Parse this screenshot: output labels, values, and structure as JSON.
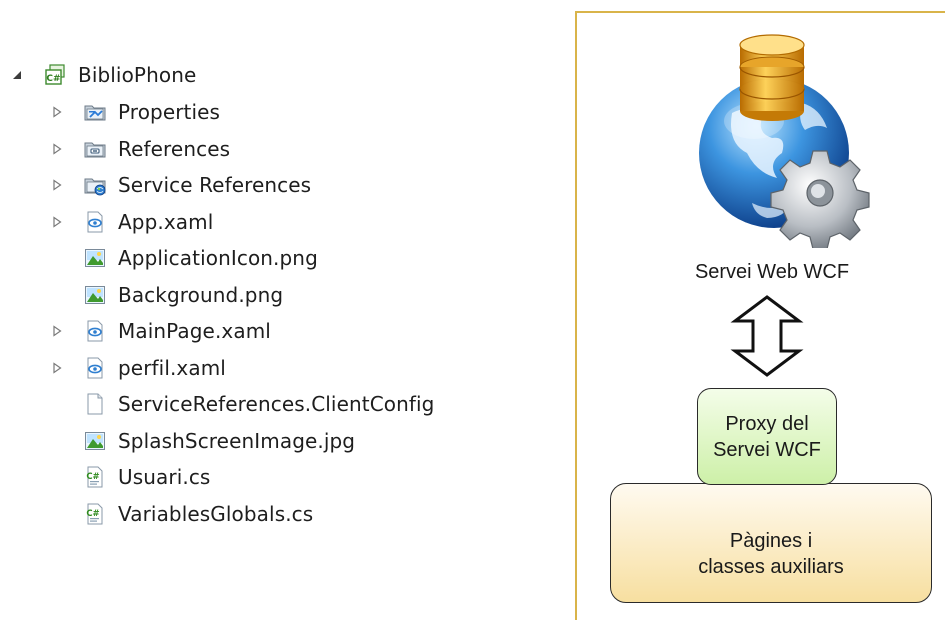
{
  "solution_explorer": {
    "project": {
      "label": "BiblioPhone",
      "icon": "csharp-project-icon",
      "expanded": true
    },
    "items": [
      {
        "label": "Properties",
        "icon": "properties-folder-icon",
        "expandable": true
      },
      {
        "label": "References",
        "icon": "references-folder-icon",
        "expandable": true
      },
      {
        "label": "Service References",
        "icon": "service-references-folder-icon",
        "expandable": true
      },
      {
        "label": "App.xaml",
        "icon": "xaml-file-icon",
        "expandable": true
      },
      {
        "label": "ApplicationIcon.png",
        "icon": "image-file-icon",
        "expandable": false
      },
      {
        "label": "Background.png",
        "icon": "image-file-icon",
        "expandable": false
      },
      {
        "label": "MainPage.xaml",
        "icon": "xaml-file-icon",
        "expandable": true
      },
      {
        "label": "perfil.xaml",
        "icon": "xaml-file-icon",
        "expandable": true
      },
      {
        "label": "ServiceReferences.ClientConfig",
        "icon": "config-file-icon",
        "expandable": false
      },
      {
        "label": "SplashScreenImage.jpg",
        "icon": "image-file-icon",
        "expandable": false
      },
      {
        "label": "Usuari.cs",
        "icon": "csharp-file-icon",
        "expandable": false
      },
      {
        "label": "VariablesGlobals.cs",
        "icon": "csharp-file-icon",
        "expandable": false
      }
    ]
  },
  "diagram": {
    "service_label": "Servei Web WCF",
    "proxy_lines": [
      "Proxy del",
      "Servei WCF"
    ],
    "pages_lines": [
      "Pàgines i",
      "classes auxiliars"
    ],
    "colors": {
      "frame": "#d9b44a",
      "proxy_fill": "#cdf0a8",
      "pages_fill": "#f7dfa0",
      "globe": "#2f7fd0",
      "database": "#e3a21a"
    },
    "icons": [
      "database-icon",
      "globe-icon",
      "gear-icon",
      "double-arrow-icon"
    ]
  }
}
